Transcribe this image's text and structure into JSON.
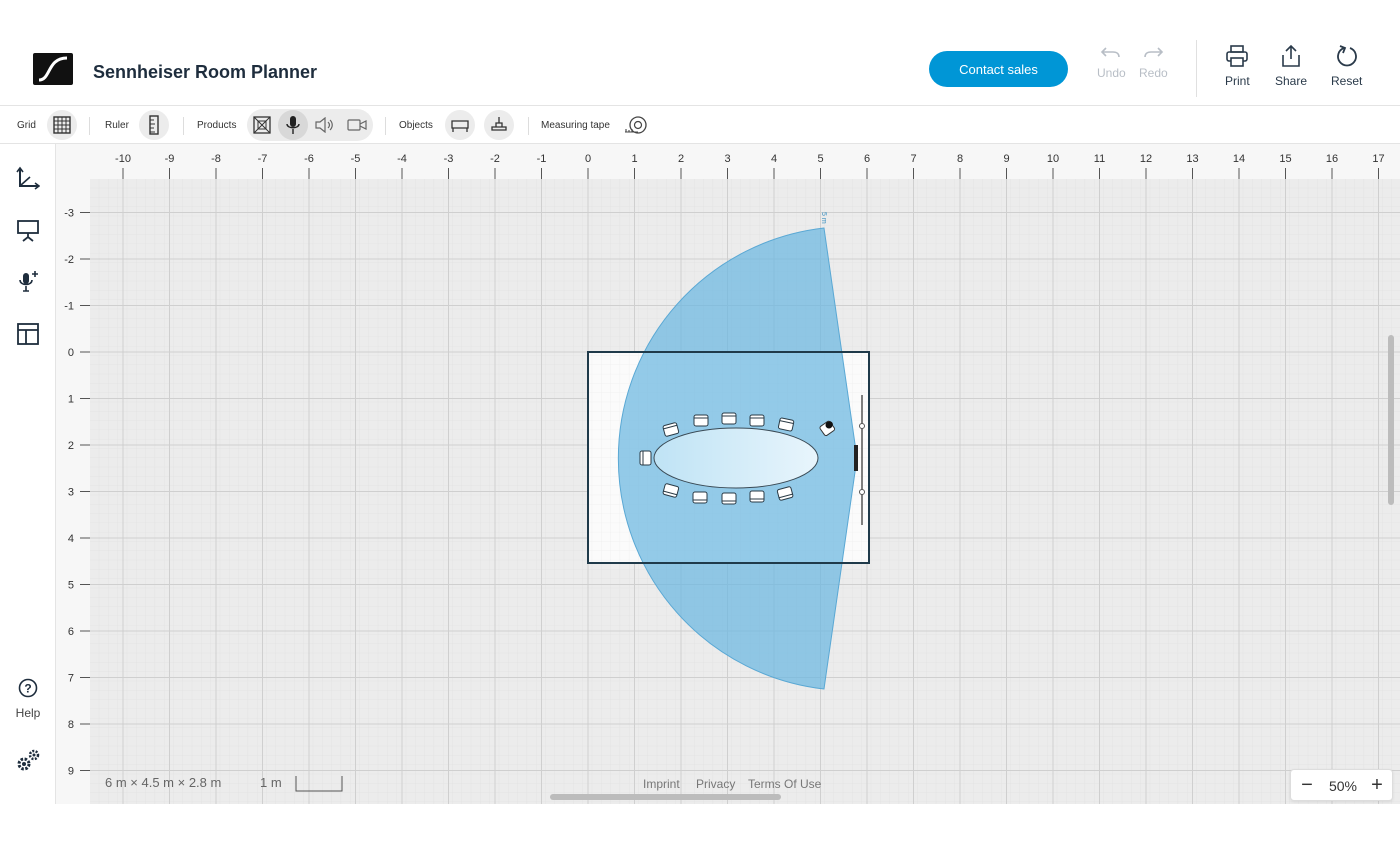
{
  "header": {
    "title": "Sennheiser Room Planner",
    "contact_label": "Contact sales",
    "undo_label": "Undo",
    "redo_label": "Redo",
    "print_label": "Print",
    "share_label": "Share",
    "reset_label": "Reset",
    "accent_color": "#0096d6"
  },
  "toolbar": {
    "grid_label": "Grid",
    "ruler_label": "Ruler",
    "products_label": "Products",
    "objects_label": "Objects",
    "measuring_label": "Measuring tape",
    "active_product": "microphone-icon"
  },
  "sidebar": {
    "items": [
      "axes-icon",
      "presentation-screen-icon",
      "add-microphone-icon",
      "layout-icon"
    ],
    "help_label": "Help",
    "settings_icon": "gears-icon"
  },
  "canvas": {
    "x_ticks": [
      "-10",
      "-9",
      "-8",
      "-7",
      "-6",
      "-5",
      "-4",
      "-3",
      "-2",
      "-1",
      "0",
      "1",
      "2",
      "3",
      "4",
      "5",
      "6",
      "7",
      "8",
      "9",
      "10",
      "11",
      "12",
      "13",
      "14",
      "15",
      "16",
      "17"
    ],
    "y_ticks": [
      "-3",
      "-2",
      "-1",
      "0",
      "1",
      "2",
      "3",
      "4",
      "5",
      "6",
      "7",
      "8",
      "9"
    ],
    "room_width_m": 6,
    "room_depth_m": 4.5,
    "coverage_label": "5 m",
    "coverage_color": "#6bb7e0"
  },
  "footer": {
    "room_dims": "6 m × 4.5 m × 2.8 m",
    "scale_label": "1 m",
    "imprint": "Imprint",
    "privacy": "Privacy",
    "terms": "Terms Of Use"
  },
  "zoom": {
    "value": "50%",
    "minus": "−",
    "plus": "+"
  }
}
